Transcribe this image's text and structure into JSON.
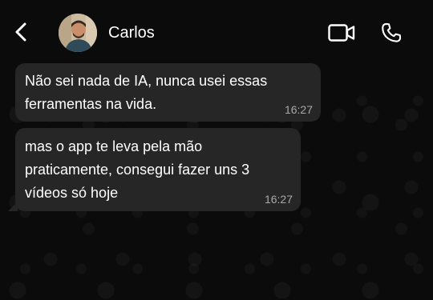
{
  "header": {
    "contact_name": "Carlos",
    "back_icon": "chevron-left-icon",
    "video_icon": "video-camera-icon",
    "call_icon": "phone-icon"
  },
  "messages": [
    {
      "text": "Não sei nada de IA, nunca usei essas\nferramentas na vida.",
      "time": "16:27"
    },
    {
      "text": "mas o app te leva pela mão\npraticamente, consegui fazer uns 3\nvídeos só hoje",
      "time": "16:27"
    }
  ],
  "colors": {
    "background": "#0b0b0b",
    "bubble": "#262626",
    "text": "#ffffff",
    "timestamp": "#a9a9a9"
  }
}
